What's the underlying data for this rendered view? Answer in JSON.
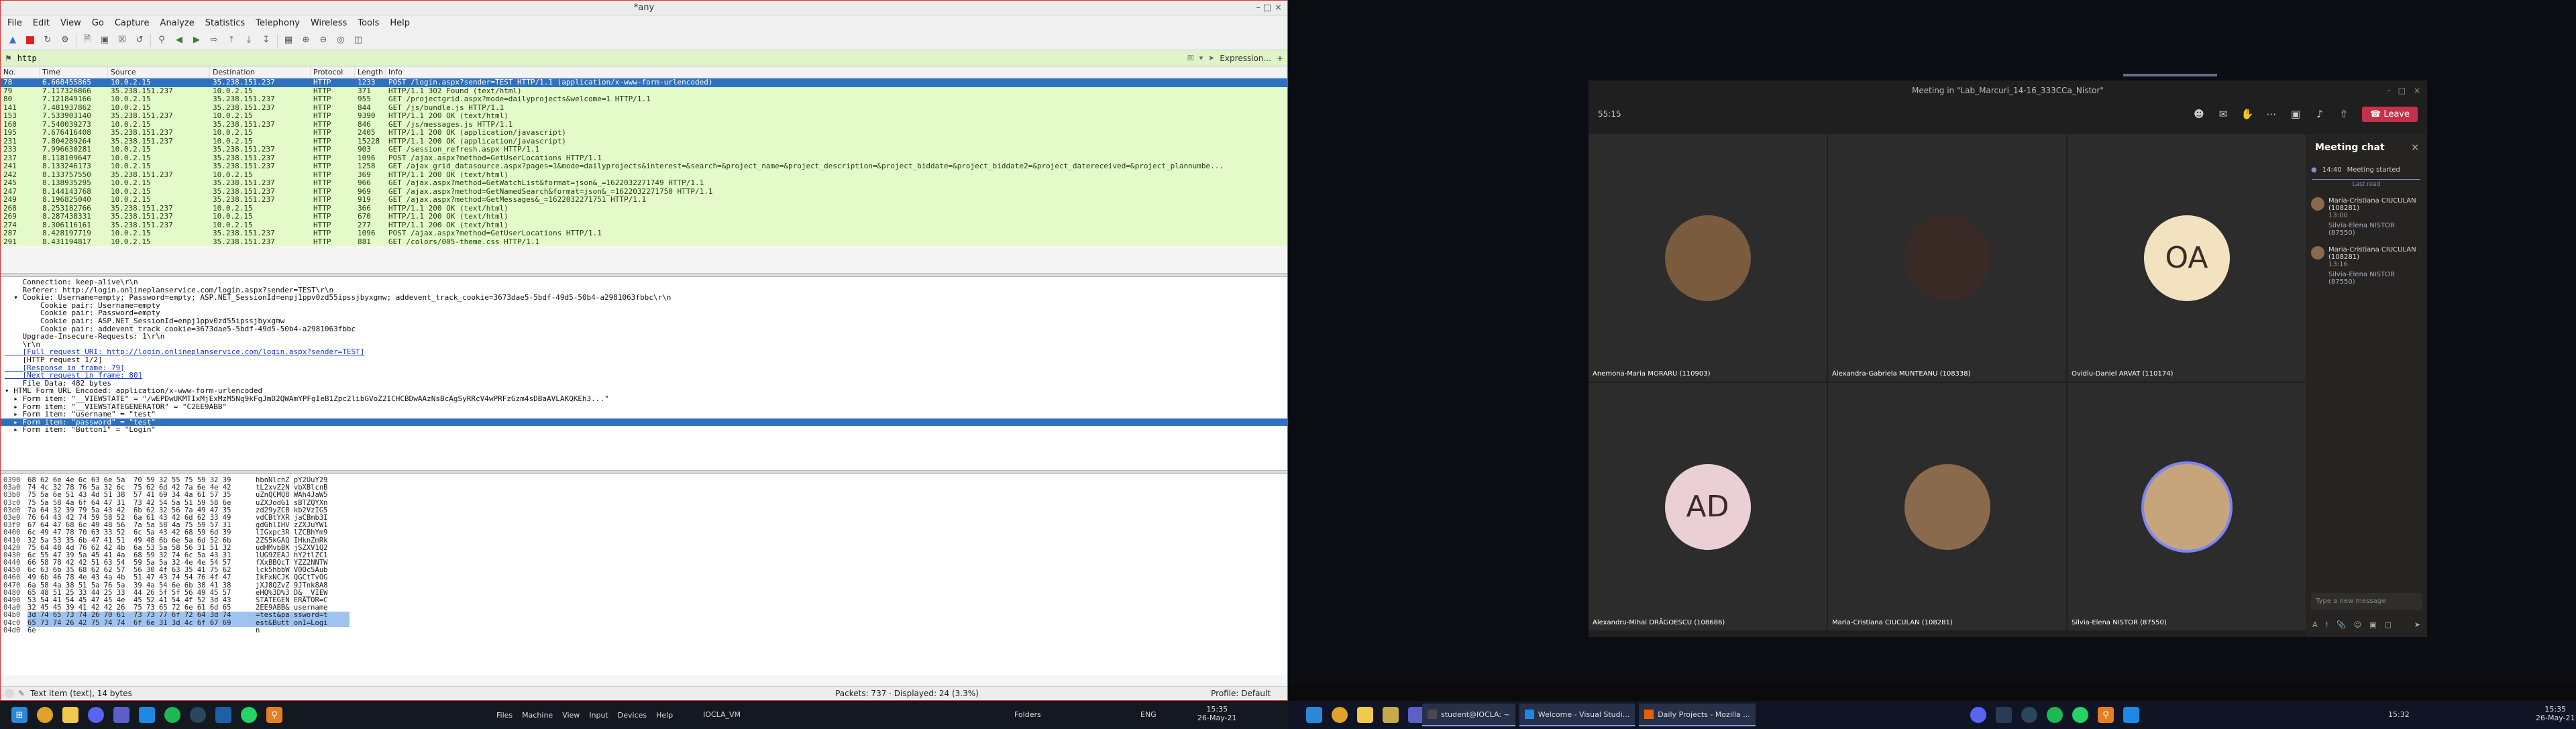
{
  "wireshark": {
    "title": "*any",
    "menu": [
      "File",
      "Edit",
      "View",
      "Go",
      "Capture",
      "Analyze",
      "Statistics",
      "Telephony",
      "Wireless",
      "Tools",
      "Help"
    ],
    "filter": {
      "value": "http",
      "expression_label": "Expression...",
      "plus_label": "+"
    },
    "columns": [
      "No.",
      "Time",
      "Source",
      "Destination",
      "Protocol",
      "Length",
      "Info"
    ],
    "packets": [
      {
        "no": "78",
        "time": "6.668455865",
        "src": "10.0.2.15",
        "dst": "35.238.151.237",
        "proto": "HTTP",
        "len": "1233",
        "info": "POST /login.aspx?sender=TEST HTTP/1.1  (application/x-www-form-urlencoded)",
        "selected": true
      },
      {
        "no": "79",
        "time": "7.117326866",
        "src": "35.238.151.237",
        "dst": "10.0.2.15",
        "proto": "HTTP",
        "len": "371",
        "info": "HTTP/1.1 302 Found  (text/html)"
      },
      {
        "no": "80",
        "time": "7.121849166",
        "src": "10.0.2.15",
        "dst": "35.238.151.237",
        "proto": "HTTP",
        "len": "955",
        "info": "GET /projectgrid.aspx?mode=dailyprojects&welcome=1 HTTP/1.1"
      },
      {
        "no": "141",
        "time": "7.481937862",
        "src": "10.0.2.15",
        "dst": "35.238.151.237",
        "proto": "HTTP",
        "len": "844",
        "info": "GET /js/bundle.js HTTP/1.1"
      },
      {
        "no": "153",
        "time": "7.533903140",
        "src": "35.238.151.237",
        "dst": "10.0.2.15",
        "proto": "HTTP",
        "len": "9390",
        "info": "HTTP/1.1 200 OK  (text/html)"
      },
      {
        "no": "160",
        "time": "7.540039273",
        "src": "10.0.2.15",
        "dst": "35.238.151.237",
        "proto": "HTTP",
        "len": "846",
        "info": "GET /js/messages.js HTTP/1.1"
      },
      {
        "no": "195",
        "time": "7.676416408",
        "src": "35.238.151.237",
        "dst": "10.0.2.15",
        "proto": "HTTP",
        "len": "2405",
        "info": "HTTP/1.1 200 OK  (application/javascript)"
      },
      {
        "no": "231",
        "time": "7.804289264",
        "src": "35.238.151.237",
        "dst": "10.0.2.15",
        "proto": "HTTP",
        "len": "15228",
        "info": "HTTP/1.1 200 OK  (application/javascript)"
      },
      {
        "no": "233",
        "time": "7.996630281",
        "src": "10.0.2.15",
        "dst": "35.238.151.237",
        "proto": "HTTP",
        "len": "903",
        "info": "GET /session_refresh.aspx HTTP/1.1"
      },
      {
        "no": "237",
        "time": "8.118109647",
        "src": "10.0.2.15",
        "dst": "35.238.151.237",
        "proto": "HTTP",
        "len": "1096",
        "info": "POST /ajax.aspx?method=GetUserLocations HTTP/1.1"
      },
      {
        "no": "241",
        "time": "8.133246173",
        "src": "10.0.2.15",
        "dst": "35.238.151.237",
        "proto": "HTTP",
        "len": "1258",
        "info": "GET /ajax_grid_datasource.aspx?pages=1&mode=dailyprojects&interest=&search=&project_name=&project_description=&project_biddate=&project_biddate2=&project_datereceived=&project_plannumbe..."
      },
      {
        "no": "242",
        "time": "8.133757550",
        "src": "35.238.151.237",
        "dst": "10.0.2.15",
        "proto": "HTTP",
        "len": "369",
        "info": "HTTP/1.1 200 OK  (text/html)"
      },
      {
        "no": "245",
        "time": "8.138935295",
        "src": "10.0.2.15",
        "dst": "35.238.151.237",
        "proto": "HTTP",
        "len": "966",
        "info": "GET /ajax.aspx?method=GetWatchList&format=json&_=1622032271749 HTTP/1.1"
      },
      {
        "no": "247",
        "time": "8.144143768",
        "src": "10.0.2.15",
        "dst": "35.238.151.237",
        "proto": "HTTP",
        "len": "969",
        "info": "GET /ajax.aspx?method=GetNamedSearch&format=json&_=1622032271750 HTTP/1.1"
      },
      {
        "no": "249",
        "time": "8.196825040",
        "src": "10.0.2.15",
        "dst": "35.238.151.237",
        "proto": "HTTP",
        "len": "919",
        "info": "GET /ajax.aspx?method=GetMessages&_=1622032271751 HTTP/1.1"
      },
      {
        "no": "268",
        "time": "8.253182766",
        "src": "35.238.151.237",
        "dst": "10.0.2.15",
        "proto": "HTTP",
        "len": "366",
        "info": "HTTP/1.1 200 OK  (text/html)"
      },
      {
        "no": "269",
        "time": "8.287438331",
        "src": "35.238.151.237",
        "dst": "10.0.2.15",
        "proto": "HTTP",
        "len": "670",
        "info": "HTTP/1.1 200 OK  (text/html)"
      },
      {
        "no": "274",
        "time": "8.306116161",
        "src": "35.238.151.237",
        "dst": "10.0.2.15",
        "proto": "HTTP",
        "len": "277",
        "info": "HTTP/1.1 200 OK  (text/html)"
      },
      {
        "no": "287",
        "time": "8.428197719",
        "src": "10.0.2.15",
        "dst": "35.238.151.237",
        "proto": "HTTP",
        "len": "1096",
        "info": "POST /ajax.aspx?method=GetUserLocations HTTP/1.1"
      },
      {
        "no": "291",
        "time": "8.431194817",
        "src": "10.0.2.15",
        "dst": "35.238.151.237",
        "proto": "HTTP",
        "len": "881",
        "info": "GET /colors/005-theme.css HTTP/1.1"
      }
    ],
    "details": [
      {
        "text": "    Connection: keep-alive\\r\\n"
      },
      {
        "text": "    Referer: http://login.onlineplanservice.com/login.aspx?sender=TEST\\r\\n"
      },
      {
        "text": "  ▾ Cookie: Username=empty; Password=empty; ASP.NET_SessionId=enpj1ppv0zd55ipssjbyxgmw; addevent_track_cookie=3673dae5-5bdf-49d5-50b4-a2981063fbbc\\r\\n"
      },
      {
        "text": "        Cookie pair: Username=empty"
      },
      {
        "text": "        Cookie pair: Password=empty"
      },
      {
        "text": "        Cookie pair: ASP.NET_SessionId=enpj1ppv0zd55ipssjbyxgmw"
      },
      {
        "text": "        Cookie pair: addevent_track_cookie=3673dae5-5bdf-49d5-50b4-a2981063fbbc"
      },
      {
        "text": "    Upgrade-Insecure-Requests: 1\\r\\n"
      },
      {
        "text": "    \\r\\n"
      },
      {
        "text": "    [Full request URI: http://login.onlineplanservice.com/login.aspx?sender=TEST]",
        "link": true
      },
      {
        "text": "    [HTTP request 1/2]"
      },
      {
        "text": "    [Response in frame: 79]",
        "link": true
      },
      {
        "text": "    [Next request in frame: 80]",
        "link": true
      },
      {
        "text": "    File Data: 482 bytes"
      },
      {
        "text": "▾ HTML Form URL Encoded: application/x-www-form-urlencoded"
      },
      {
        "text": "  ▸ Form item: \"__VIEWSTATE\" = \"/wEPDwUKMTIxMjExMzM5Ng9kFgJmD2QWAmYPFgIeB1Zpc2libGVoZ2ICHCBDwAAzNsBcAgSyRRcV4wPRFzGzm4sDBaAVLAKQKEh3...\""
      },
      {
        "text": "  ▸ Form item: \"__VIEWSTATEGENERATOR\" = \"C2EE9ABB\""
      },
      {
        "text": "  ▸ Form item: \"username\" = \"test\""
      },
      {
        "text": "  ▸ Form item: \"password\" = \"test\"",
        "selected": true
      },
      {
        "text": "  ▸ Form item: \"Button1\" = \"Login\""
      }
    ],
    "hex": [
      {
        "off": "0390",
        "bytes": "68 62 6e 4e 6c 63 6e 5a  70 59 32 55 75 59 32 39",
        "ascii": "hbnNlcnZ pY2UuY29"
      },
      {
        "off": "03a0",
        "bytes": "74 4c 32 78 76 5a 32 6c  75 62 6d 42 7a 6e 4e 42",
        "ascii": "tL2xvZ2N vbXBlcnB"
      },
      {
        "off": "03b0",
        "bytes": "75 5a 6e 51 43 4d 51 38  57 41 69 34 4a 61 57 35",
        "ascii": "uZnQCMQ8 WAh4JaW5"
      },
      {
        "off": "03c0",
        "bytes": "75 5a 58 4a 6f 64 47 31  73 42 54 5a 51 59 58 6e",
        "ascii": "uZXJodG1 sBTZQYXn"
      },
      {
        "off": "03d0",
        "bytes": "7a 64 32 39 79 5a 43 42  6b 62 32 56 7a 49 47 35",
        "ascii": "zd29yZCB kb2VzIG5"
      },
      {
        "off": "03e0",
        "bytes": "76 64 43 42 74 59 58 52  6a 61 43 42 6d 62 33 49",
        "ascii": "vdCBtYXR jaCBmb3I"
      },
      {
        "off": "03f0",
        "bytes": "67 64 47 68 6c 49 48 56  7a 5a 58 4a 75 59 57 31",
        "ascii": "gdGhlIHV zZXJuYW1"
      },
      {
        "off": "0400",
        "bytes": "6c 49 47 78 70 63 33 52  6c 5a 43 42 68 59 6d 39",
        "ascii": "lIGxpc3R lZCBhYm9"
      },
      {
        "off": "0410",
        "bytes": "32 5a 53 35 6b 47 41 51  49 48 6b 6e 5a 6d 52 6b",
        "ascii": "2ZS5kGAQ IHknZmRk"
      },
      {
        "off": "0420",
        "bytes": "75 64 48 4d 76 62 42 4b  6a 53 5a 58 56 31 51 32",
        "ascii": "udHMvbBK jSZXV1Q2"
      },
      {
        "off": "0430",
        "bytes": "6c 55 47 39 5a 45 41 4a  68 59 32 74 6c 5a 43 31",
        "ascii": "lUG9ZEAJ hY2tlZC1"
      },
      {
        "off": "0440",
        "bytes": "66 58 78 42 42 51 63 54  59 5a 5a 32 4e 4e 54 57",
        "ascii": "fXxBBQcT YZZ2NNTW"
      },
      {
        "off": "0450",
        "bytes": "6c 63 6b 35 68 62 62 57  56 30 4f 63 35 41 75 62",
        "ascii": "lck5hbbW V0Oc5Aub"
      },
      {
        "off": "0460",
        "bytes": "49 6b 46 78 4e 43 4a 4b  51 47 43 74 54 76 4f 47",
        "ascii": "IkFxNCJK QGCtTvOG"
      },
      {
        "off": "0470",
        "bytes": "6a 58 4a 38 51 5a 76 5a  39 4a 54 6e 6b 38 41 38",
        "ascii": "jXJ8QZvZ 9JTnk8A8"
      },
      {
        "off": "0480",
        "bytes": "65 48 51 25 33 44 25 33  44 26 5f 5f 56 49 45 57",
        "ascii": "eHQ%3D%3 D&__VIEW"
      },
      {
        "off": "0490",
        "bytes": "53 54 41 54 45 47 45 4e  45 52 41 54 4f 52 3d 43",
        "ascii": "STATEGEN ERATOR=C"
      },
      {
        "off": "04a0",
        "bytes": "32 45 45 39 41 42 42 26  75 73 65 72 6e 61 6d 65",
        "ascii": "2EE9ABB& username"
      },
      {
        "off": "04b0",
        "bytes": "3d 74 65 73 74 26 70 61  73 73 77 6f 72 64 3d 74",
        "ascii": "=test&pa ssword=t",
        "hl": true
      },
      {
        "off": "04c0",
        "bytes": "65 73 74 26 42 75 74 74  6f 6e 31 3d 4c 6f 67 69",
        "ascii": "est&Butt on1=Logi",
        "hl": true
      },
      {
        "off": "04d0",
        "bytes": "6e",
        "ascii": "n"
      }
    ],
    "status": {
      "left": "Text item (text), 14 bytes",
      "middle": "Packets: 737 · Displayed: 24 (3.3%)",
      "right": "Profile: Default"
    }
  },
  "left_taskbar": {
    "items": [
      "Files",
      "Machine",
      "View",
      "Input",
      "Devices",
      "Help"
    ],
    "vm_name": "IOCLA_VM",
    "folders_label": "Folders",
    "lang": "ENG",
    "time": "15:35",
    "date": "26-May-21"
  },
  "teams": {
    "title": "Meeting in \"Lab_Marcuri_14-16_333CCa_Nistor\"",
    "timer": "55:15",
    "leave_label": "Leave",
    "tiles": [
      {
        "name": "Anemona-Maria MORARU (110903)",
        "initials": "",
        "color": "#7b5b3e"
      },
      {
        "name": "Alexandra-Gabriela MUNTEANU (108338)",
        "initials": "",
        "color": "#3a2a26"
      },
      {
        "name": "Ovidiu-Daniel ARVAT (110174)",
        "initials": "OA",
        "color": "#f3e2bf"
      },
      {
        "name": "Alexandru-Mihai DRĂGOESCU (108686)",
        "initials": "AD",
        "color": "#ead0d4"
      },
      {
        "name": "Maria-Cristiana CIUCULAN (108281)",
        "initials": "",
        "color": "#8a6a4c"
      },
      {
        "name": "Silvia-Elena NISTOR (87550)",
        "initials": "",
        "color": "#c6a57d"
      }
    ],
    "chat": {
      "title": "Meeting chat",
      "started_time": "14:40",
      "started_label": "Meeting started",
      "last_read": "Last read",
      "messages": [
        {
          "name": "Maria-Cristiana CIUCULAN (108281)",
          "time": "13:00",
          "text": "Silvia-Elena NISTOR (87550)"
        },
        {
          "name": "Maria-Cristiana CIUCULAN (108281)",
          "time": "13:16",
          "text": "Silvia-Elena NISTOR (87550)"
        }
      ],
      "input_placeholder": "Type a new message"
    }
  },
  "right_taskbar": {
    "windows": [
      "student@IOCLA: ~",
      "Welcome - Visual Studi...",
      "Daily Projects - Mozilla ..."
    ],
    "time": "15:32",
    "clock_time": "15:35",
    "date": "26-May-21"
  }
}
